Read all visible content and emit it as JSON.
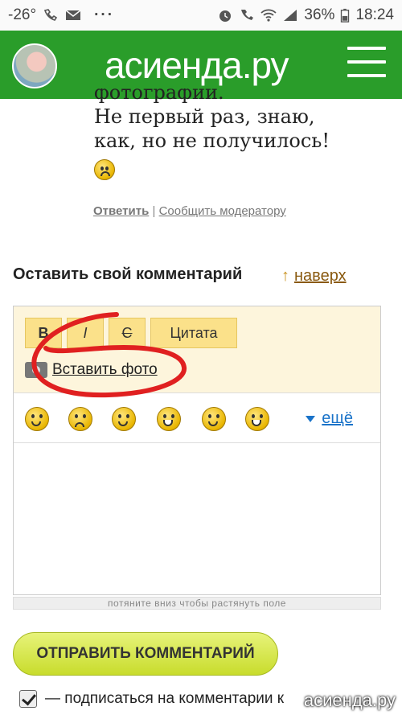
{
  "status_bar": {
    "temperature": "-26°",
    "battery": "36%",
    "time": "18:24",
    "more": "···"
  },
  "header": {
    "site_name": "асиенда.ру",
    "menu_icon": "hamburger-icon"
  },
  "comment": {
    "clipped_line": "фотографии.",
    "lines": [
      "Не первый раз, знаю,",
      "как, но не получилось!"
    ],
    "reply_label": "Ответить",
    "separator": "|",
    "report_label": "Сообщить модератору"
  },
  "form": {
    "title": "Оставить свой комментарий",
    "to_top_arrow": "↑",
    "to_top_label": "наверх",
    "toolbar": {
      "bold": "B",
      "italic": "I",
      "strike": "C",
      "quote": "Цитата",
      "insert_photo": "Вставить фото"
    },
    "more_label": "ещё",
    "textarea_value": "",
    "resize_hint": "потяните вниз чтобы растянуть поле",
    "submit_label": "ОТПРАВИТЬ КОММЕНТАРИЙ",
    "subscribe_label": "— подписаться на комментарии к",
    "subscribe_checked": true
  },
  "watermark": "асиенда.ру",
  "colors": {
    "header_green": "#2a9d2a",
    "toolbar_bg": "#fdf5dc",
    "button_yellow": "#fbe18a",
    "submit_green": "#c8dc2c",
    "annotation_red": "#e02020",
    "link_blue": "#1a73c9"
  }
}
